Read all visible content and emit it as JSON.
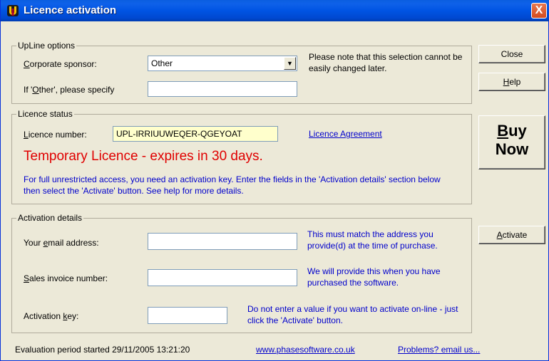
{
  "window": {
    "title": "Licence activation",
    "close_glyph": "X"
  },
  "upline": {
    "legend": "UpLine options",
    "sponsor_label_prefix": "C",
    "sponsor_label_rest": "orporate sponsor:",
    "sponsor_value": "Other",
    "specify_label_pre": "If '",
    "specify_label_u": "O",
    "specify_label_post": "ther', please specify",
    "specify_value": "",
    "note": "Please note that this selection cannot be easily changed later."
  },
  "licence": {
    "legend": "Licence status",
    "number_label_prefix": "L",
    "number_label_rest": "icence number:",
    "number_value": "UPL-IRRIUUWEQER-QGEYOAT",
    "agreement_link": "Licence Agreement",
    "temporary_text": "Temporary Licence - expires in 30 days.",
    "info_text": "For full unrestricted access, you need an activation key. Enter the fields in the 'Activation details' section below then select the 'Activate' button. See help for more details."
  },
  "activation": {
    "legend": "Activation details",
    "email_label_pre": "Your ",
    "email_label_u": "e",
    "email_label_post": "mail address:",
    "email_value": "",
    "email_note": "This must match the address you provide(d) at the time of purchase.",
    "invoice_label_u": "S",
    "invoice_label_post": "ales invoice number:",
    "invoice_value": "",
    "invoice_note": "We will provide this when you have purchased the software.",
    "key_label_pre": "Activation ",
    "key_label_u": "k",
    "key_label_post": "ey:",
    "key_value": "",
    "key_note": "Do not enter a value if you want to activate on-line - just click the 'Activate' button."
  },
  "buttons": {
    "close": "Close",
    "help_u": "H",
    "help_rest": "elp",
    "buy_line1_u": "B",
    "buy_line1_rest": "uy",
    "buy_line2": "Now",
    "activate_u": "A",
    "activate_rest": "ctivate"
  },
  "status_bar": {
    "evaluation": "Evaluation period started 29/11/2005 13:21:20",
    "website_link": "www.phasesoftware.co.uk",
    "problems_link": "Problems? email us..."
  },
  "colors": {
    "titlebar": "#0054e3",
    "temporary_text": "#e00000",
    "link": "#0000cc",
    "licence_field_bg": "#ffffcc"
  }
}
